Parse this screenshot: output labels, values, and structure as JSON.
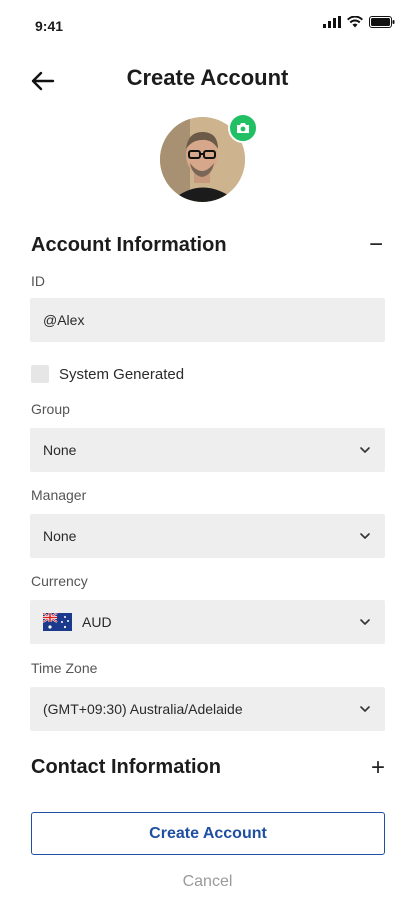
{
  "status_bar": {
    "time": "9:41"
  },
  "header": {
    "title": "Create Account"
  },
  "avatar": {
    "badge_icon": "camera-icon",
    "badge_color": "#22c064"
  },
  "account_section": {
    "title": "Account Information",
    "toggle": "−",
    "id_label": "ID",
    "id_value": "@Alex",
    "system_generated_label": "System Generated",
    "system_generated_checked": false,
    "group_label": "Group",
    "group_value": "None",
    "manager_label": "Manager",
    "manager_value": "None",
    "currency_label": "Currency",
    "currency_value": "AUD",
    "currency_flag_icon": "australia-flag-icon",
    "timezone_label": "Time Zone",
    "timezone_value": "(GMT+09:30) Australia/Adelaide"
  },
  "contact_section": {
    "title": "Contact Information",
    "toggle": "+"
  },
  "actions": {
    "create_label": "Create Account",
    "cancel_label": "Cancel"
  },
  "colors": {
    "primary": "#1f4fa0",
    "field_bg": "#eeeeee",
    "cancel": "#9a9a9a"
  }
}
